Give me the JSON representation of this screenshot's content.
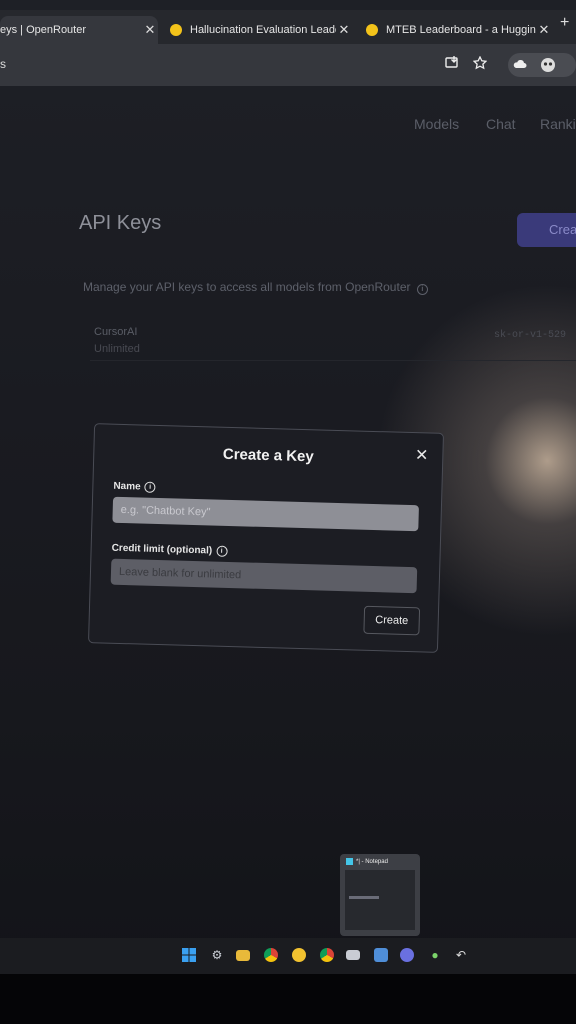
{
  "browser": {
    "tabs": [
      {
        "title": "eys | OpenRouter",
        "active": true
      },
      {
        "title": "Hallucination Evaluation Leade",
        "active": false
      },
      {
        "title": "MTEB Leaderboard - a Hugging",
        "active": false
      }
    ],
    "close_glyph": "✕",
    "new_tab": "+",
    "url": "s",
    "icons": [
      "install-app-icon",
      "star-icon",
      "profile-icon"
    ]
  },
  "page": {
    "nav": {
      "models": "Models",
      "chat": "Chat",
      "rankings": "Ranki"
    },
    "title": "API Keys",
    "create_button": "Crea",
    "description": "Manage your API keys to access all models from OpenRouter",
    "keys": [
      {
        "name": "CursorAI",
        "limit": "Unlimited",
        "value": "sk-or-v1-529"
      }
    ]
  },
  "modal": {
    "title": "Create a Key",
    "close": "✕",
    "name_label": "Name",
    "name_placeholder": "e.g. \"Chatbot Key\"",
    "credit_label": "Credit limit (optional)",
    "credit_placeholder": "Leave blank for unlimited",
    "create_button": "Create"
  },
  "taskbar": {
    "notepad_preview_title": "*| - Notepad",
    "icons": [
      "windows-icon",
      "settings-icon",
      "file-explorer-icon",
      "chrome-icon",
      "app-icon",
      "chrome-icon",
      "mail-icon",
      "app-icon",
      "discord-icon",
      "android-icon",
      "app-icon"
    ]
  },
  "colors": {
    "accent": "#3a3a7a",
    "modal_bg": "#1c1d23",
    "tab_favicon": "#f3c31a"
  }
}
